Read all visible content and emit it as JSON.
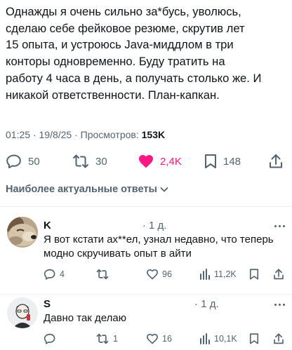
{
  "post": {
    "lines": [
      "Однажды я очень сильно за*бусь, уволюсь,",
      "сделаю себе фейковое резюме, скрутив лет",
      "15 опыта, и устроюсь Java-миддлом в три",
      "конторы одновременно. Буду тратить на",
      "работу 4 часа в день, а получать столько же. И",
      "никакой ответственности. План-капкан."
    ],
    "time": "01:25",
    "date": "19/8/25",
    "views_label": "Просмотров:",
    "views": "153K",
    "sep": "·",
    "actions": {
      "replies": "50",
      "reposts": "30",
      "likes": "2,4K",
      "bookmarks": "148"
    },
    "like_color": "#f91880"
  },
  "replies_sort": {
    "label": "Наиболее актуальные ответы"
  },
  "replies": [
    {
      "name": "K",
      "time": "· 1 д.",
      "text": "Я вот кстати ах**ел, узнал недавно, что теперь модно скручивать опыт в айти",
      "actions": {
        "replies": "4",
        "reposts": "",
        "likes": "96",
        "views": "11,2K"
      }
    },
    {
      "name": "S",
      "time": "· 1 д.",
      "text": "Давно так делаю",
      "actions": {
        "replies": "",
        "reposts": "1",
        "likes": "16",
        "views": "10,1K"
      }
    }
  ]
}
